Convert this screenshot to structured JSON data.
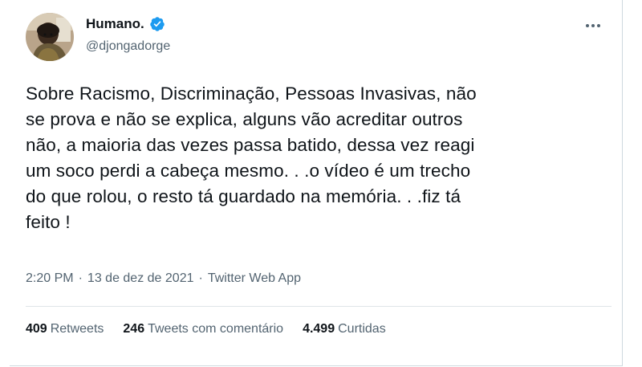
{
  "author": {
    "display_name": "Humano.",
    "handle": "@djongadorge",
    "verified": true
  },
  "icons": {
    "avatar": "avatar-photo",
    "verified": "verified-badge-icon",
    "more": "more-dots-icon"
  },
  "colors": {
    "verified_blue": "#1d9bf0",
    "secondary_text": "#536471",
    "primary_text": "#0f1419"
  },
  "tweet": {
    "text": "Sobre Racismo, Discriminação, Pessoas Invasivas, não\nse prova e não se explica, alguns vão acreditar outros\nnão, a maioria das vezes passa batido, dessa vez reagi\num soco perdi a cabeça mesmo. . .o vídeo é um trecho\ndo que rolou, o resto tá guardado na memória. . .fiz tá\nfeito !",
    "time": "2:20 PM",
    "date": "13 de dez de 2021",
    "source": "Twitter Web App",
    "separator": "·"
  },
  "stats": {
    "retweets": {
      "count": "409",
      "label": "Retweets"
    },
    "quotes": {
      "count": "246",
      "label": "Tweets com comentário"
    },
    "likes": {
      "count": "4.499",
      "label": "Curtidas"
    }
  }
}
